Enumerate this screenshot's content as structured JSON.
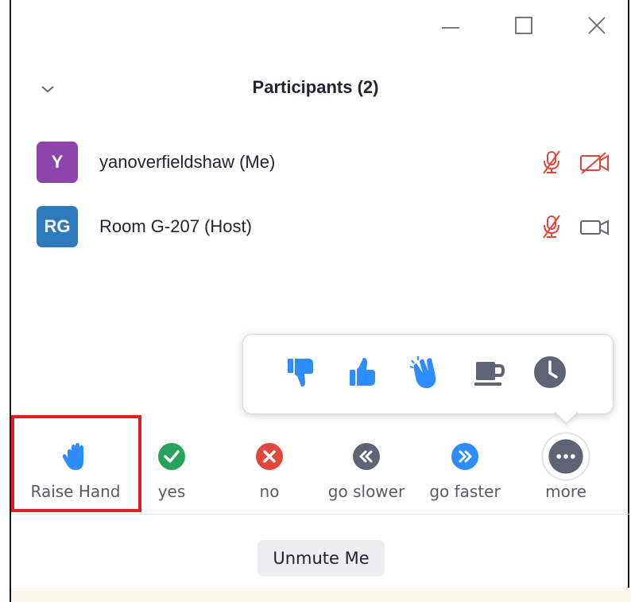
{
  "header": {
    "title": "Participants (2)"
  },
  "participants": [
    {
      "initials": "Y",
      "name": "yanoverfieldshaw (Me)",
      "avatar_color": "#8e44ad",
      "mic": "muted",
      "video": "off"
    },
    {
      "initials": "RG",
      "name": "Room G-207 (Host)",
      "avatar_color": "#2d7bbd",
      "mic": "muted",
      "video": "on"
    }
  ],
  "reactions": [
    "thumbs-down-icon",
    "thumbs-up-icon",
    "clap-icon",
    "coffee-cup-icon",
    "clock-icon"
  ],
  "actions": {
    "raise_hand": "Raise Hand",
    "yes": "yes",
    "no": "no",
    "go_slower": "go slower",
    "go_faster": "go faster",
    "more": "more"
  },
  "unmute_label": "Unmute Me",
  "colors": {
    "accent_blue": "#2d8cff",
    "yes_green": "#26a35b",
    "no_red": "#e0463a",
    "gray_icon": "#5f6475",
    "muted_red": "#e0463a",
    "highlight_red": "#e11d22"
  }
}
